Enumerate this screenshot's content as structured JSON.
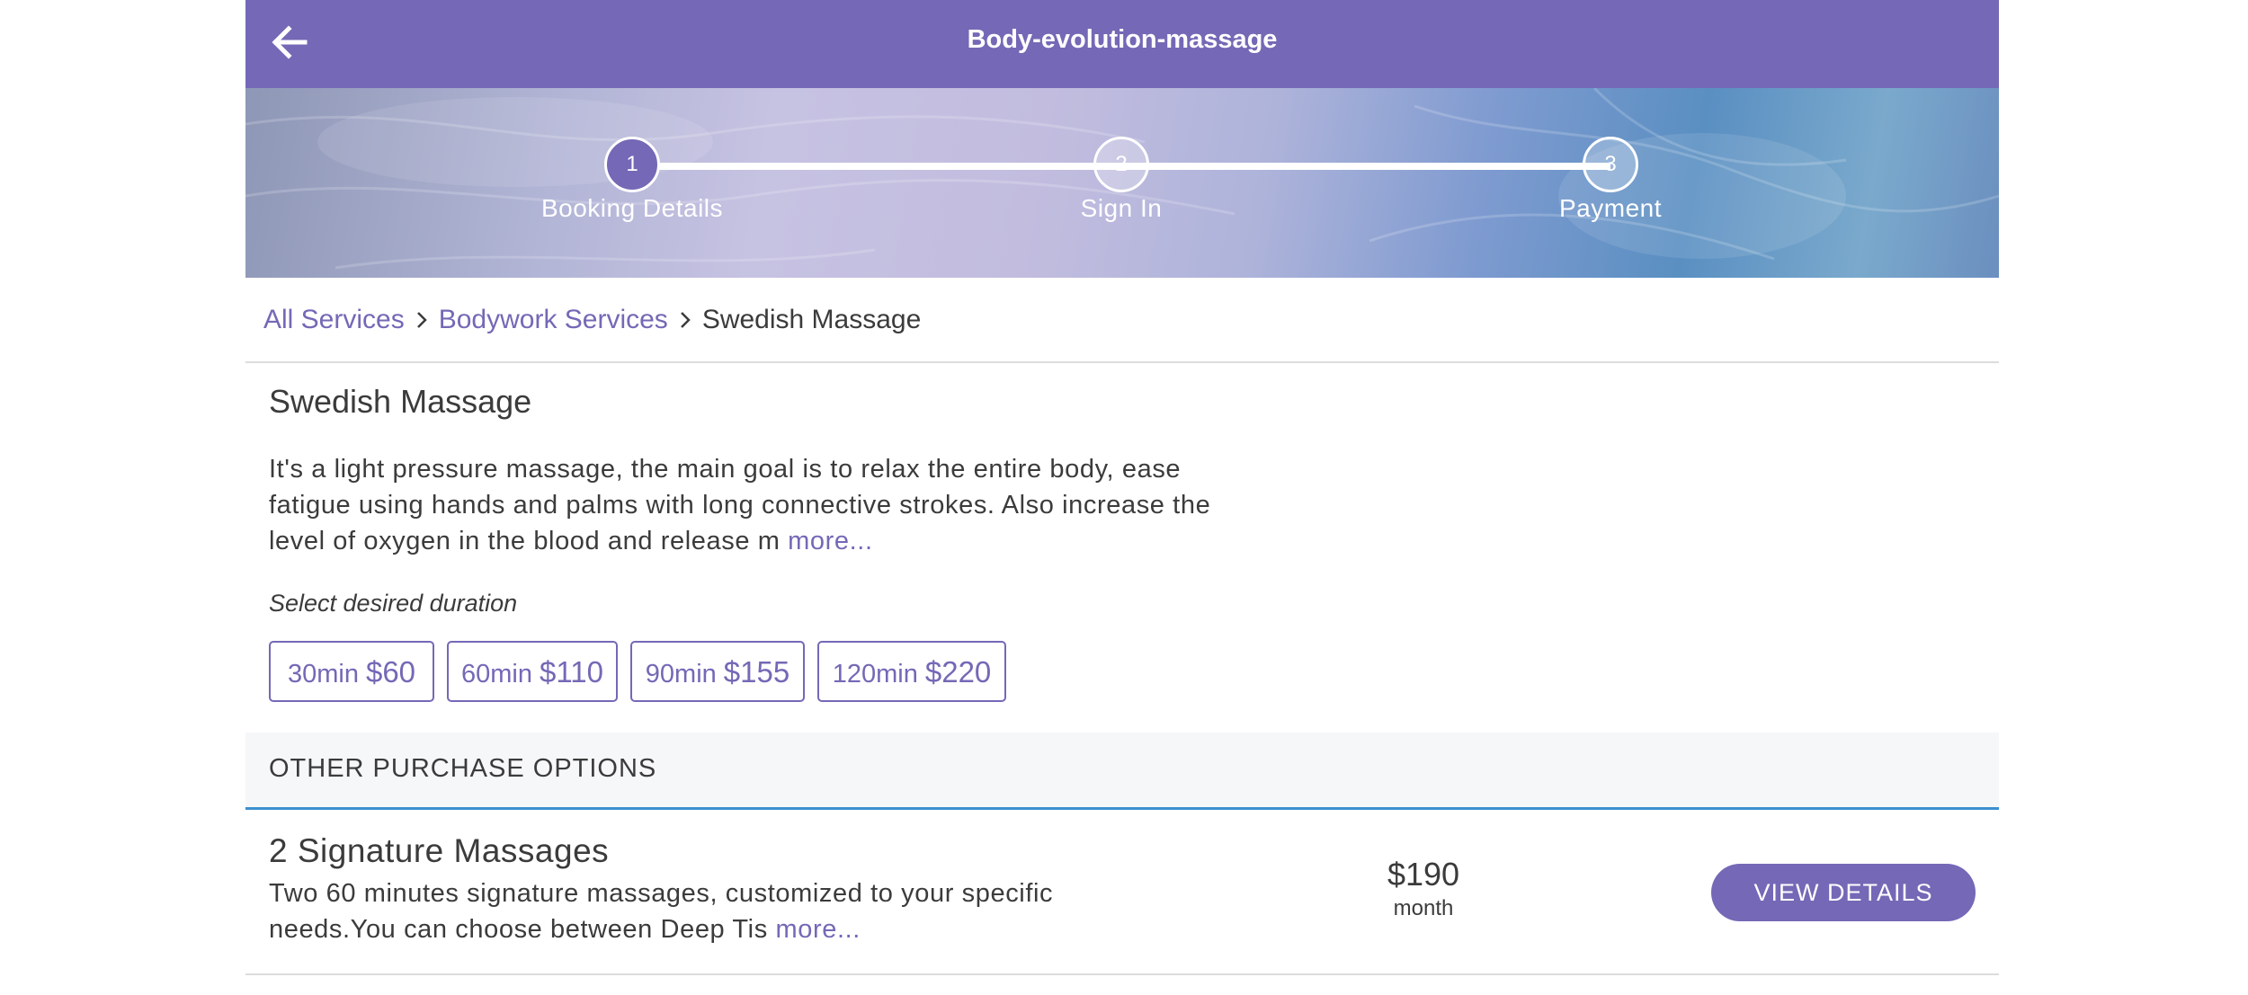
{
  "header": {
    "title": "Body-evolution-massage",
    "back_icon": "arrow-left-icon",
    "background": "#7568b6"
  },
  "steps": [
    {
      "number": "1",
      "label": "Booking Details",
      "active": true
    },
    {
      "number": "2",
      "label": "Sign In",
      "active": false
    },
    {
      "number": "3",
      "label": "Payment",
      "active": false
    }
  ],
  "breadcrumb": {
    "items": [
      {
        "label": "All Services",
        "link": true
      },
      {
        "label": "Bodywork Services",
        "link": true
      },
      {
        "label": "Swedish Massage",
        "link": false
      }
    ],
    "separator_icon": "chevron-right-icon"
  },
  "service": {
    "title": "Swedish Massage",
    "description": "It's a light pressure massage, the main goal is to relax the entire body, ease fatigue using hands and palms with long connective strokes. Also increase the level of oxygen in the blood and release m",
    "more_label": "more...",
    "duration_prompt": "Select desired duration",
    "durations": [
      {
        "minutes": "30min",
        "price": "$60"
      },
      {
        "minutes": "60min",
        "price": "$110"
      },
      {
        "minutes": "90min",
        "price": "$155"
      },
      {
        "minutes": "120min",
        "price": "$220"
      }
    ]
  },
  "other_options": {
    "header": "OTHER PURCHASE OPTIONS",
    "items": [
      {
        "title": "2 Signature Massages",
        "description": "Two 60 minutes signature massages, customized to your specific needs.You can choose between Deep Tis",
        "more_label": "more...",
        "price": "$190",
        "period": "month",
        "button_label": "VIEW DETAILS"
      }
    ]
  },
  "colors": {
    "accent": "#7568b6",
    "divider_blue": "#3b8fd0",
    "text": "#3b3b3b"
  }
}
